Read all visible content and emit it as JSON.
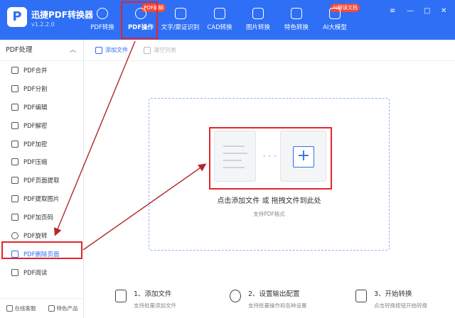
{
  "app": {
    "title": "迅捷PDF转换器",
    "version": "v1.2.2.0",
    "logo_letter": "P"
  },
  "nav": [
    {
      "label": "PDF转换",
      "icon": "convert-icon"
    },
    {
      "label": "PDF操作",
      "icon": "pdf-ops-icon",
      "active": true,
      "badge": "PDF编辑"
    },
    {
      "label": "文字/票证识别",
      "icon": "ocr-icon"
    },
    {
      "label": "CAD转换",
      "icon": "cad-icon"
    },
    {
      "label": "图片转换",
      "icon": "image-icon"
    },
    {
      "label": "特色转换",
      "icon": "special-icon"
    },
    {
      "label": "AI大模型",
      "icon": "ai-icon",
      "badge": "AI解读文档"
    }
  ],
  "sidebar": {
    "header": "PDF处理",
    "items": [
      {
        "label": "PDF合并"
      },
      {
        "label": "PDF分割"
      },
      {
        "label": "PDF编辑"
      },
      {
        "label": "PDF解密"
      },
      {
        "label": "PDF加密"
      },
      {
        "label": "PDF压缩"
      },
      {
        "label": "PDF页面提取"
      },
      {
        "label": "PDF提取图片"
      },
      {
        "label": "PDF加页码"
      },
      {
        "label": "PDF旋转"
      },
      {
        "label": "PDF删除页面",
        "active": true
      },
      {
        "label": "PDF阅读"
      }
    ],
    "footer": {
      "service": "在线客服",
      "products": "特色产品"
    }
  },
  "toolbar": {
    "add": "添加文件",
    "clear": "清空列表"
  },
  "drop": {
    "title": "点击添加文件 或 拖拽文件到此处",
    "subtitle": "支持PDF格式",
    "arrows": "› › ›",
    "plus": "+"
  },
  "steps": [
    {
      "title": "1、添加文件",
      "sub": "支持批量添加文件"
    },
    {
      "title": "2、设置输出配置",
      "sub": "支持批量操作和各种设置"
    },
    {
      "title": "3、开始转换",
      "sub": "点击转换按钮开始转换"
    }
  ],
  "colors": {
    "brand": "#2e6ff5",
    "highlight": "#e0262c",
    "badge": "#f24a3a"
  }
}
